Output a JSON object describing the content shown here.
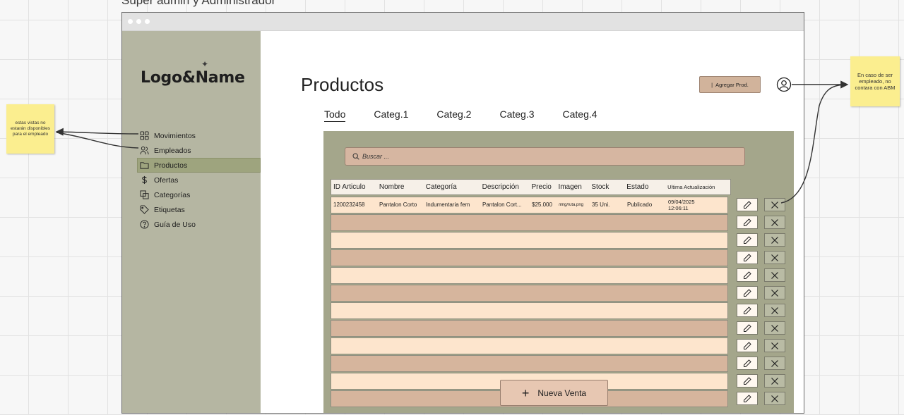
{
  "board_title": "Super admin y Administrador",
  "brand": {
    "logo_text": "Logo&Name"
  },
  "sidebar": {
    "items": [
      {
        "label": "Movimientos",
        "icon": "grid-icon"
      },
      {
        "label": "Empleados",
        "icon": "users-icon"
      },
      {
        "label": "Productos",
        "icon": "folder-icon",
        "active": true
      },
      {
        "label": "Ofertas",
        "icon": "dollar-icon"
      },
      {
        "label": "Categorías",
        "icon": "copy-icon"
      },
      {
        "label": "Etiquetas",
        "icon": "tag-icon"
      },
      {
        "label": "Guía de Uso",
        "icon": "help-icon"
      }
    ]
  },
  "main": {
    "title": "Productos",
    "add_button_label": "Agregar Prod.",
    "tabs": [
      "Todo",
      "Categ.1",
      "Categ.2",
      "Categ.3",
      "Categ.4"
    ],
    "search_placeholder": "Buscar ...",
    "table": {
      "headers": [
        "ID Articulo",
        "Nombre",
        "Categoría",
        "Descripción",
        "Precio",
        "Imagen",
        "Stock",
        "Estado",
        "Ultima Actualización"
      ],
      "first_row": {
        "id": "1200232458",
        "nombre": "Pantalon Corto",
        "categoria": "Indumentaria fem",
        "descripcion": "Pantalon Cort...",
        "precio": "$25.000",
        "imagen": "/img/ruta.png",
        "stock": "35 Uni.",
        "estado": "Publicado",
        "fecha": "09/04/2025",
        "hora": "12:06:11"
      }
    },
    "new_sale_label": "Nueva Venta"
  },
  "notes": {
    "left": "estas vistas no estarán disponibles para el empleado",
    "right": "En caso de ser empleado, no contara con ABM"
  },
  "colors": {
    "sidebar": "#b5b6a2",
    "panel": "#a4a68b",
    "row_light": "#fde5cd",
    "row_dark": "#d6b59d",
    "sticky_note": "#fbee8f"
  }
}
